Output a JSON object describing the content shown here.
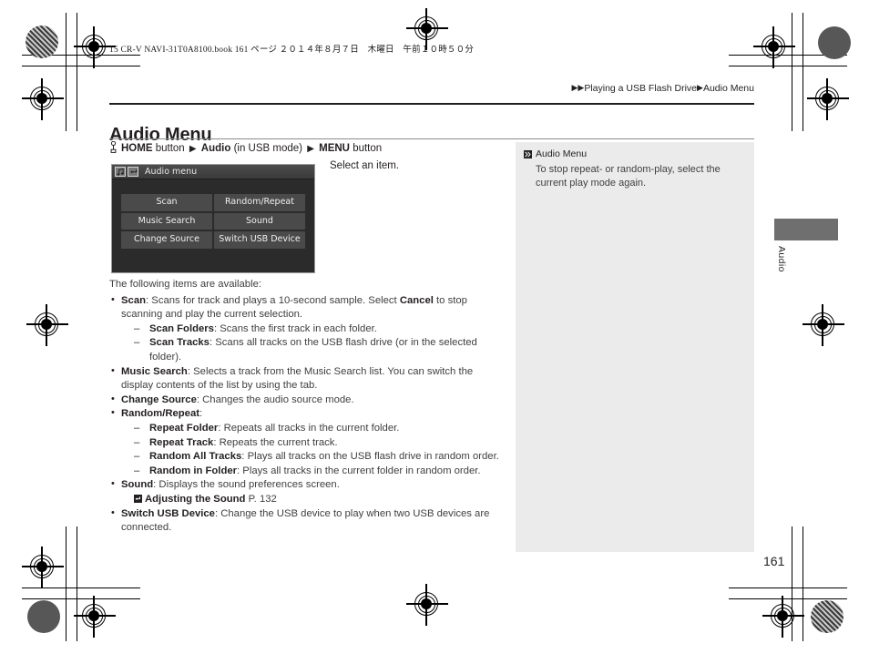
{
  "print_header": {
    "book_line": "15 CR-V NAVI-31T0A8100.book   161 ページ   ２０１４年８月７日　木曜日　午前１０時５０分"
  },
  "breadcrumb": {
    "arrow": "▶",
    "parent": "Playing a USB Flash Drive",
    "current": "Audio Menu"
  },
  "page": {
    "title": "Audio Menu",
    "folio": "161",
    "thumb_label": "Audio"
  },
  "nav_path": {
    "finger_icon": "hand-press-icon",
    "home_button": "HOME",
    "button_word_1": "button",
    "arrow": "▶",
    "audio": "Audio",
    "mode_note": "(in USB mode)",
    "menu_button": "MENU",
    "button_word_2": "button"
  },
  "screen_mock": {
    "icon_note": "music-note-icon",
    "icon_back": "return-arrow-icon",
    "title": "Audio menu",
    "buttons": [
      "Scan",
      "Random/Repeat",
      "Music Search",
      "Sound",
      "Change Source",
      "Switch USB Device"
    ]
  },
  "caption": "Select an item.",
  "body": {
    "lead": "The following items are available:",
    "items": [
      {
        "term": "Scan",
        "desc_1": ": Scans for track and plays a 10-second sample. Select ",
        "emphasis": "Cancel",
        "desc_2": " to stop scanning and play the current selection.",
        "sub": [
          {
            "term": "Scan Folders",
            "desc": ": Scans the first track in each folder."
          },
          {
            "term": "Scan Tracks",
            "desc": ": Scans all tracks on the USB flash drive (or in the selected folder)."
          }
        ]
      },
      {
        "term": "Music Search",
        "desc": ": Selects a track from the Music Search list. You can switch the display contents of the list by using the tab."
      },
      {
        "term": "Change Source",
        "desc": ": Changes the audio source mode."
      },
      {
        "term": "Random/Repeat",
        "desc": ":",
        "sub": [
          {
            "term": "Repeat Folder",
            "desc": ": Repeats all tracks in the current folder."
          },
          {
            "term": "Repeat Track",
            "desc": ": Repeats the current track."
          },
          {
            "term": "Random All Tracks",
            "desc": ": Plays all tracks on the USB flash drive in random order."
          },
          {
            "term": "Random in Folder",
            "desc": ": Plays all tracks in the current folder in random order."
          }
        ]
      },
      {
        "term": "Sound",
        "desc": ": Displays the sound preferences screen.",
        "xref": {
          "icon": "page-link-icon",
          "title": "Adjusting the Sound",
          "page": "P. 132"
        }
      },
      {
        "term": "Switch USB Device",
        "desc": ": Change the USB device to play when two USB devices are connected."
      }
    ]
  },
  "sidenote": {
    "marker_icon": "note-marker-icon",
    "title": "Audio Menu",
    "text": "To stop repeat- or random-play, select the current play mode again."
  },
  "colors": {
    "page_bg": "#ffffff",
    "ink": "#231f20",
    "body_text": "#3f3f3f",
    "sidenote_bg": "#ebebeb",
    "screen_bg": "#2b2b2b",
    "screen_button": "#4a4a4a",
    "thumb_tab": "#6f6f6f"
  }
}
